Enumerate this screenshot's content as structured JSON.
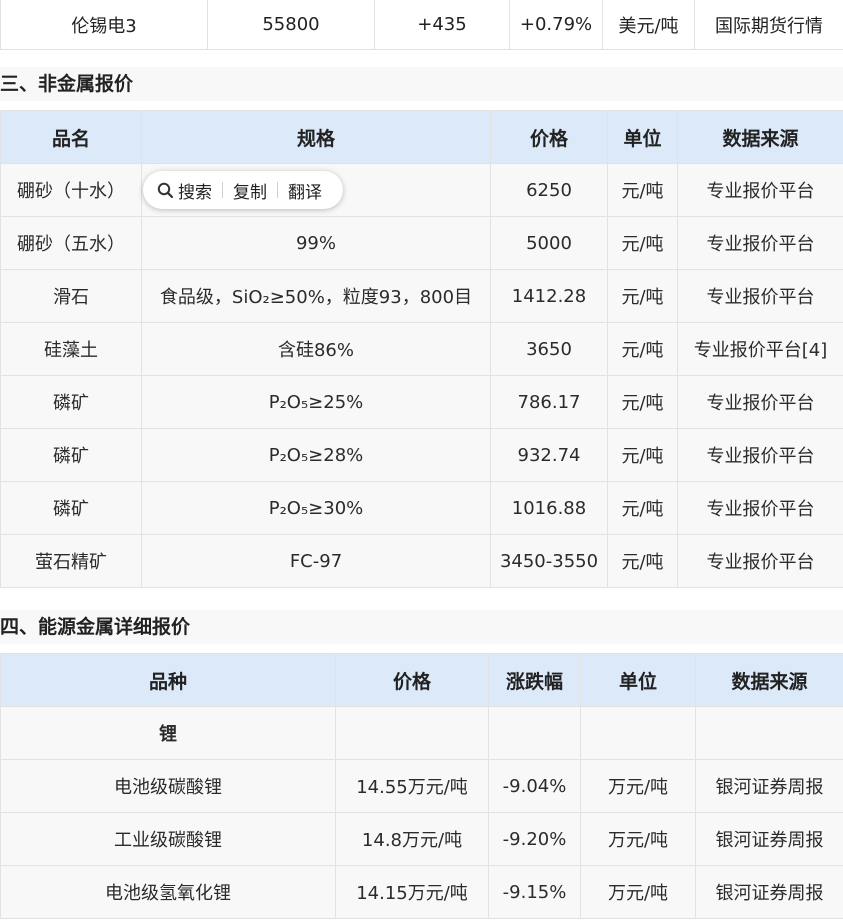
{
  "top_row": [
    "伦锡电3",
    "55800",
    "+435",
    "+0.79%",
    "美元/吨",
    "国际期货行情"
  ],
  "section3": {
    "title": "三、非金属报价",
    "headers": [
      "品名",
      "规格",
      "价格",
      "单位",
      "数据来源"
    ],
    "rows": [
      [
        "硼砂（十水）",
        "",
        "6250",
        "元/吨",
        "专业报价平台"
      ],
      [
        "硼砂（五水）",
        "99%",
        "5000",
        "元/吨",
        "专业报价平台"
      ],
      [
        "滑石",
        "食品级，SiO₂≥50%，粒度93，800目",
        "1412.28",
        "元/吨",
        "专业报价平台"
      ],
      [
        "硅藻土",
        "含硅86%",
        "3650",
        "元/吨",
        "专业报价平台[4]"
      ],
      [
        "磷矿",
        "P₂O₅≥25%",
        "786.17",
        "元/吨",
        "专业报价平台"
      ],
      [
        "磷矿",
        "P₂O₅≥28%",
        "932.74",
        "元/吨",
        "专业报价平台"
      ],
      [
        "磷矿",
        "P₂O₅≥30%",
        "1016.88",
        "元/吨",
        "专业报价平台"
      ],
      [
        "萤石精矿",
        "FC-97",
        "3450-3550",
        "元/吨",
        "专业报价平台"
      ]
    ]
  },
  "section4": {
    "title": "四、能源金属详细报价",
    "headers": [
      "品种",
      "价格",
      "涨跌幅",
      "单位",
      "数据来源"
    ],
    "group": "锂",
    "rows": [
      [
        "电池级碳酸锂",
        "14.55万元/吨",
        "-9.04%",
        "万元/吨",
        "银河证券周报"
      ],
      [
        "工业级碳酸锂",
        "14.8万元/吨",
        "-9.20%",
        "万元/吨",
        "银河证券周报"
      ],
      [
        "电池级氢氧化锂",
        "14.15万元/吨",
        "-9.15%",
        "万元/吨",
        "银河证券周报"
      ]
    ]
  },
  "popup": {
    "search_label": "搜索",
    "copy_label": "复制",
    "translate_label": "翻译",
    "search_icon": "search-icon"
  }
}
